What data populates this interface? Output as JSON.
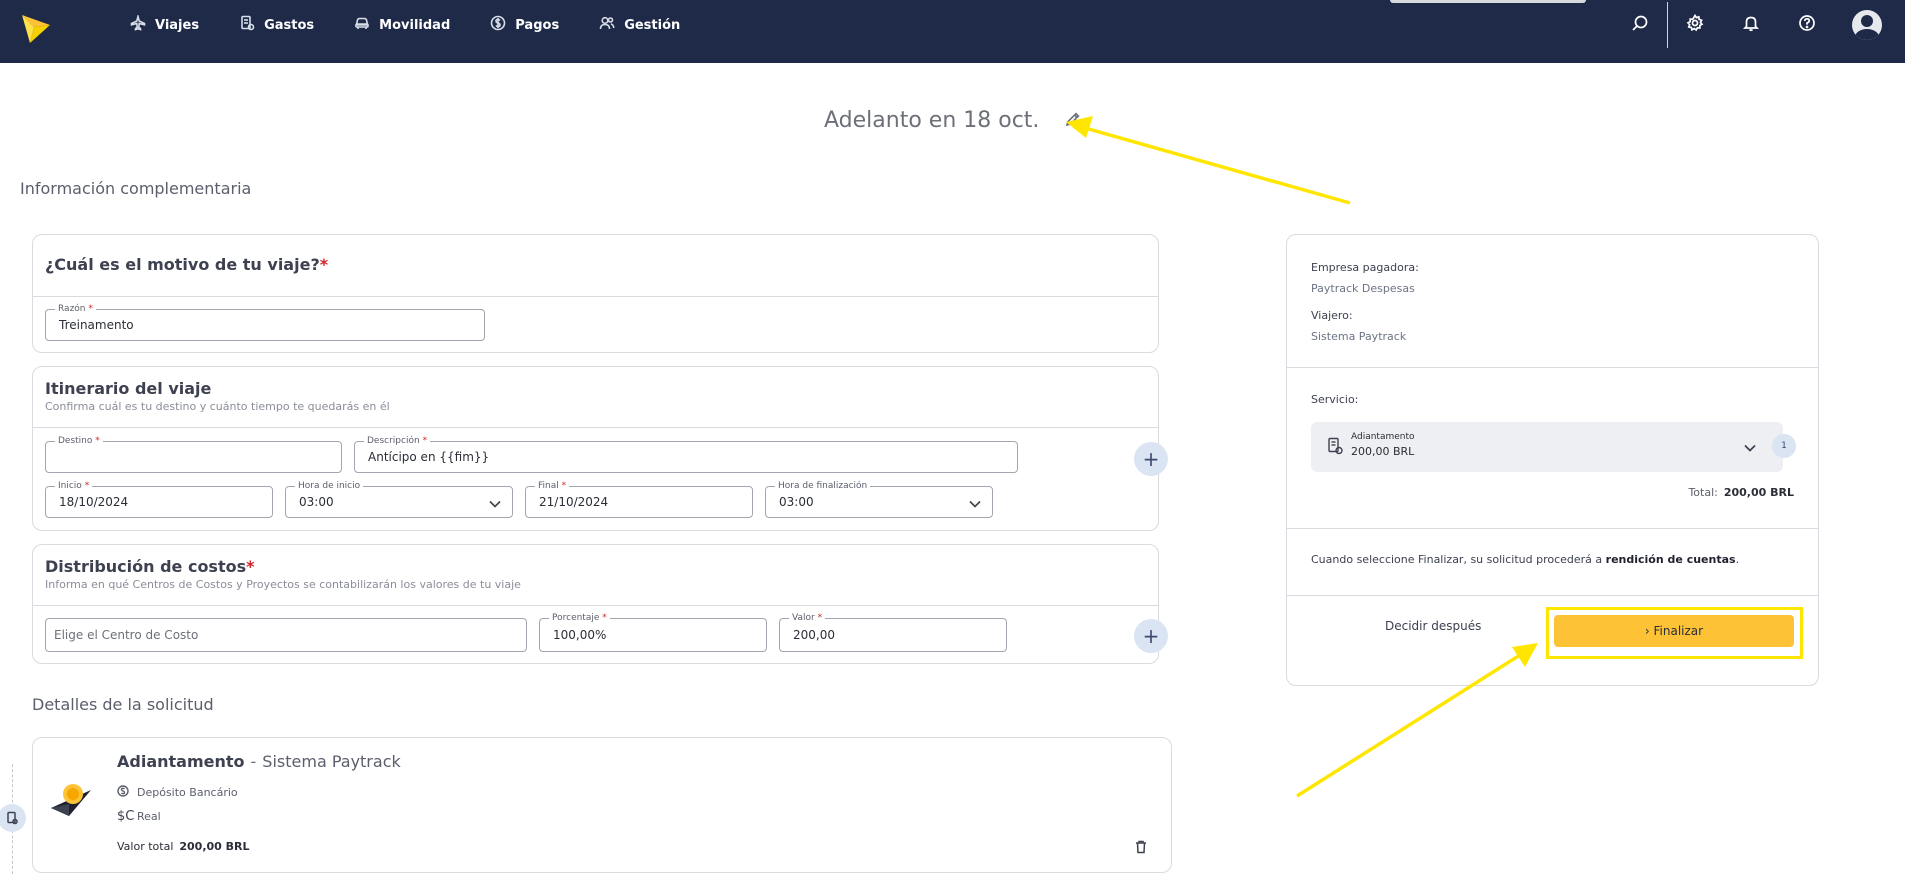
{
  "nav": {
    "items": [
      {
        "label": "Viajes",
        "icon": "plane-icon"
      },
      {
        "label": "Gastos",
        "icon": "receipt-icon"
      },
      {
        "label": "Movilidad",
        "icon": "car-icon"
      },
      {
        "label": "Pagos",
        "icon": "dollar-coin-icon"
      },
      {
        "label": "Gestión",
        "icon": "users-icon"
      }
    ],
    "colors": {
      "bar": "#1f2a48",
      "accent": "#fec236",
      "highlight": "#ffe600"
    }
  },
  "page": {
    "title": "Adelanto en 18 oct."
  },
  "sections": {
    "info": "Información complementaria",
    "details": "Detalles de la solicitud"
  },
  "motivo": {
    "title": "¿Cuál es el motivo de tu viaje?",
    "required_mark": "*",
    "razon_label": "Razón",
    "razon_value": "Treinamento"
  },
  "itinerario": {
    "title": "Itinerario del viaje",
    "subtitle": "Confirma cuál es tu destino y cuánto tiempo te quedarás en él",
    "destino_label": "Destino",
    "destino_value": "",
    "descripcion_label": "Descripción",
    "descripcion_value": "Antícipo en {{fim}}",
    "inicio_label": "Inicio",
    "inicio_value": "18/10/2024",
    "hora_inicio_label": "Hora de inicio",
    "hora_inicio_value": "03:00",
    "final_label": "Final",
    "final_value": "21/10/2024",
    "hora_fin_label": "Hora de finalización",
    "hora_fin_value": "03:00"
  },
  "costos": {
    "title": "Distribución de costos",
    "subtitle": "Informa en qué Centros de Costos y Proyectos se contabilizarán los valores de tu viaje",
    "centro_placeholder": "Elige el Centro de Costo",
    "porcentaje_label": "Porcentaje",
    "porcentaje_value": "100,00%",
    "valor_label": "Valor",
    "valor_value": "200,00"
  },
  "summary": {
    "empresa_label": "Empresa pagadora:",
    "empresa_value": "Paytrack Despesas",
    "viajero_label": "Viajero:",
    "viajero_value": "Sistema Paytrack",
    "servicio_label": "Servicio:",
    "servicio_name": "Adiantamento",
    "servicio_amount": "200,00 BRL",
    "servicio_count": "1",
    "total_label": "Total:",
    "total_value": "200,00 BRL",
    "notice_prefix": "Cuando seleccione Finalizar, su solicitud procederá a ",
    "notice_bold": "rendición de cuentas",
    "notice_suffix": ".",
    "decide_label": "Decidir después",
    "finalize_label": "› Finalizar"
  },
  "detalle": {
    "title": "Adiantamento",
    "separator": "-",
    "owner": "Sistema Paytrack",
    "payment_method": "Depósito Bancário",
    "currency": "Real",
    "currency_symbol": "$C",
    "total_label": "Valor total",
    "total_value": "200,00 BRL"
  }
}
